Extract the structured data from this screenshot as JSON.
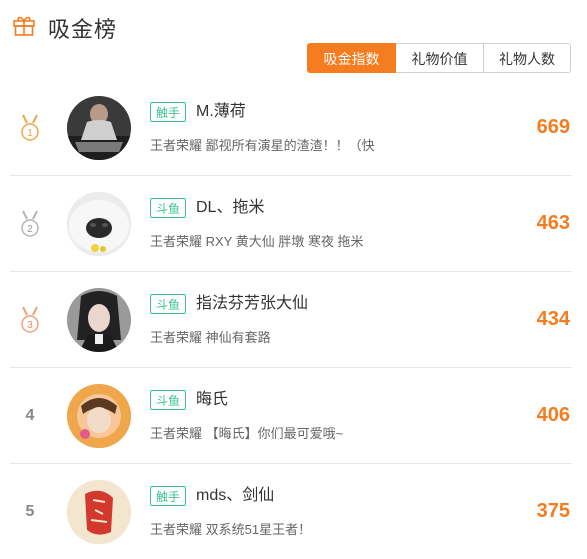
{
  "header": {
    "title": "吸金榜",
    "icon": "gift-icon",
    "accent": "#f57c1f"
  },
  "tabs": [
    {
      "label": "吸金指数",
      "active": true
    },
    {
      "label": "礼物价值",
      "active": false
    },
    {
      "label": "礼物人数",
      "active": false
    }
  ],
  "rows": [
    {
      "rank": "1",
      "medal": "gold",
      "platform": "触手",
      "name": "M.薄荷",
      "desc": "王者荣耀 鄙视所有演星的渣渣！！（快",
      "score": "669"
    },
    {
      "rank": "2",
      "medal": "silver",
      "platform": "斗鱼",
      "name": "DL、拖米",
      "desc": "王者荣耀 RXY 黄大仙 胖墩 寒夜 拖米",
      "score": "463"
    },
    {
      "rank": "3",
      "medal": "bronze",
      "platform": "斗鱼",
      "name": "指法芬芳张大仙",
      "desc": "王者荣耀 神仙有套路",
      "score": "434"
    },
    {
      "rank": "4",
      "medal": "",
      "platform": "斗鱼",
      "name": "晦氏",
      "desc": "王者荣耀 【晦氏】你们最可爱哦~",
      "score": "406"
    },
    {
      "rank": "5",
      "medal": "",
      "platform": "触手",
      "name": "mds、剑仙",
      "desc": "王者荣耀 双系统51星王者！",
      "score": "375"
    }
  ]
}
